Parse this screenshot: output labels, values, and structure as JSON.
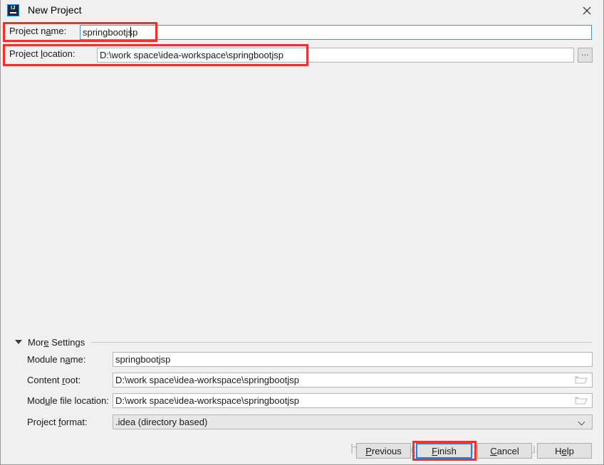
{
  "window": {
    "title": "New Project",
    "app_icon": "intellij-idea-icon",
    "icon_letters": "IJ",
    "close_icon": "close-icon"
  },
  "top_fields": {
    "project_name": {
      "label_pre": "Project n",
      "label_mnemonic": "a",
      "label_post": "me:",
      "label_full": "Project name:",
      "value": "springbootjsp"
    },
    "project_location": {
      "label_pre": "Project ",
      "label_mnemonic": "l",
      "label_post": "ocation:",
      "label_full": "Project location:",
      "value": "D:\\work space\\idea-workspace\\springbootjsp"
    },
    "browse_button_label": "...",
    "browse_icon": "ellipsis-icon"
  },
  "more_settings": {
    "label_pre": "Mor",
    "label_mnemonic": "e",
    "label_post": " Settings",
    "label_full": "More Settings",
    "expanded": true,
    "collapse_icon": "triangle-down-icon",
    "fields": [
      {
        "name": "module-name",
        "label_pre": "Module n",
        "label_mnemonic": "a",
        "label_post": "me:",
        "label_full": "Module name:",
        "value": "springbootjsp",
        "has_folder_button": false
      },
      {
        "name": "content-root",
        "label_pre": "Content ",
        "label_mnemonic": "r",
        "label_post": "oot:",
        "label_full": "Content root:",
        "value": "D:\\work space\\idea-workspace\\springbootjsp",
        "has_folder_button": true,
        "folder_icon": "folder-icon"
      },
      {
        "name": "module-file-location",
        "label_pre": "Mod",
        "label_mnemonic": "u",
        "label_post": "le file location:",
        "label_full": "Module file location:",
        "value": "D:\\work space\\idea-workspace\\springbootjsp",
        "has_folder_button": true,
        "folder_icon": "folder-icon"
      }
    ],
    "project_format": {
      "label_pre": "Project ",
      "label_mnemonic": "f",
      "label_post": "ormat:",
      "label_full": "Project format:",
      "selected": ".idea (directory based)",
      "chevron_icon": "chevron-down-icon"
    }
  },
  "buttons": {
    "previous": {
      "pre": "",
      "mnemonic": "P",
      "post": "revious",
      "full": "Previous"
    },
    "finish": {
      "pre": "",
      "mnemonic": "F",
      "post": "inish",
      "full": "Finish"
    },
    "cancel": {
      "pre": "",
      "mnemonic": "C",
      "post": "ancel",
      "full": "Cancel"
    },
    "help": {
      "pre": "H",
      "mnemonic": "e",
      "post": "lp",
      "full": "Help"
    }
  },
  "watermark": {
    "text": "https://blog.csdn.net/AdminGuan"
  },
  "annotations": {
    "color": "#f52f2f",
    "boxes": [
      "project-name-row",
      "project-location-row",
      "finish-button"
    ]
  }
}
